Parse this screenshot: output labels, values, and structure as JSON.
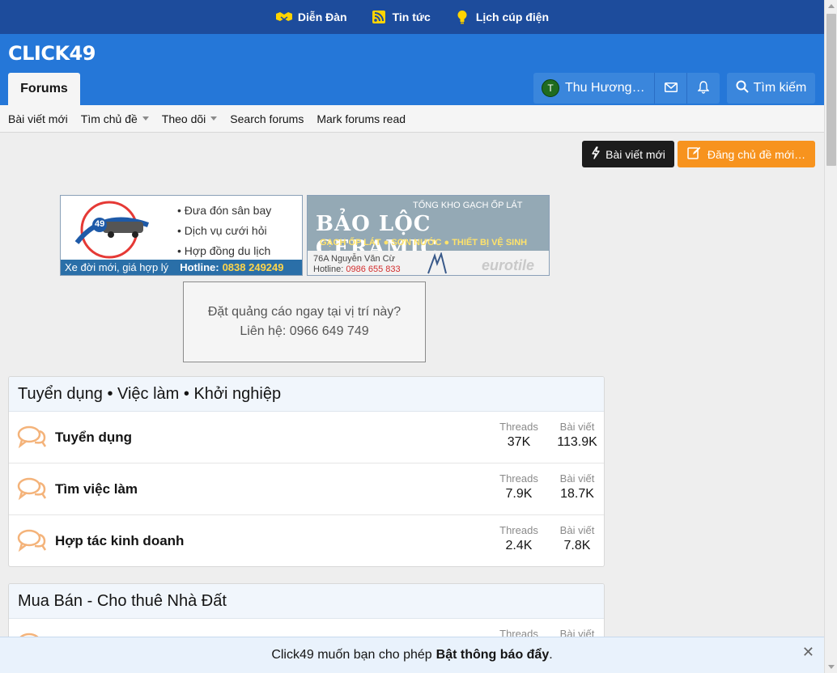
{
  "topbar": {
    "links": [
      {
        "label": "Diễn Đàn",
        "icon": "handshake-icon"
      },
      {
        "label": "Tin tức",
        "icon": "rss-icon"
      },
      {
        "label": "Lịch cúp điện",
        "icon": "lightbulb-icon"
      }
    ]
  },
  "header": {
    "logo": "CLICK49",
    "tab": "Forums",
    "user": {
      "name": "Thu Hương…",
      "avatar_letter": "T"
    },
    "search_label": "Tìm kiếm"
  },
  "subnav": {
    "items": [
      "Bài viết mới",
      "Tìm chủ đề",
      "Theo dõi",
      "Search forums",
      "Mark forums read"
    ]
  },
  "actions": {
    "new_posts": "Bài viết mới",
    "post_thread": "Đăng chủ đề mới…"
  },
  "ads": {
    "ad1": {
      "logo_text": "49",
      "items": [
        "Đưa đón sân bay",
        "Dịch vụ cưới hỏi",
        "Hợp đồng du lịch"
      ],
      "footer_text": "Xe đời mới, giá hợp lý",
      "hotline_label": "Hotline:",
      "hotline": "0838 249249"
    },
    "ad2": {
      "super": "TỔNG KHO GẠCH ỐP LÁT",
      "title": "BẢO LỘC CERAMIC",
      "tags": "GẠCH ỐP LÁT  ●  SƠN NƯỚC  ●  THIẾT BỊ VỆ SINH",
      "address": "76A Nguyễn Văn Cừ",
      "hotline_label": "Hotline:",
      "hotline": "0986 655 833",
      "brand": "eurotile"
    },
    "placeholder": {
      "line1": "Đặt quảng cáo ngay tại vị trí này?",
      "line2": "Liên hệ: 0966 649 749"
    }
  },
  "categories": [
    {
      "title": "Tuyển dụng • Việc làm • Khởi nghiệp",
      "forums": [
        {
          "name": "Tuyển dụng",
          "threads_label": "Threads",
          "threads": "37K",
          "posts_label": "Bài viết",
          "posts": "113.9K"
        },
        {
          "name": "Tìm việc làm",
          "threads_label": "Threads",
          "threads": "7.9K",
          "posts_label": "Bài viết",
          "posts": "18.7K"
        },
        {
          "name": "Hợp tác kinh doanh",
          "threads_label": "Threads",
          "threads": "2.4K",
          "posts_label": "Bài viết",
          "posts": "7.8K"
        }
      ]
    },
    {
      "title": "Mua Bán - Cho thuê Nhà Đất",
      "forums": [
        {
          "threads_label": "Threads",
          "posts_label": "Bài viết"
        }
      ]
    }
  ],
  "notice": {
    "text": "Click49 muốn bạn cho phép",
    "bold": "Bật thông báo đẩy",
    "period": ".",
    "close": "✕"
  },
  "colors": {
    "topbar": "#1d4c9c",
    "header": "#2577d8",
    "accent_orange": "#f7931e",
    "icon_orange": "#f4b37a"
  }
}
